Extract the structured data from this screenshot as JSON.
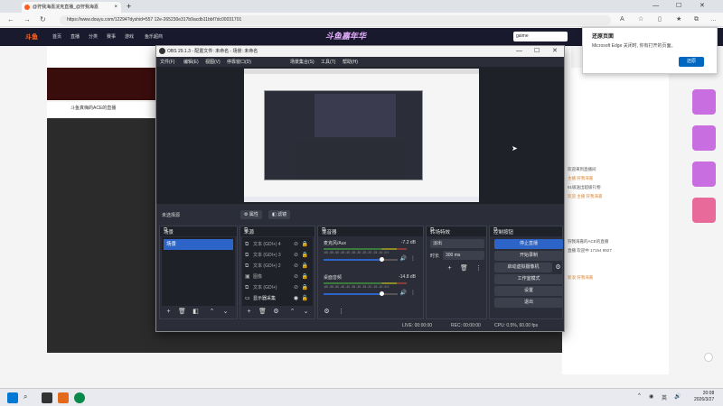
{
  "browser": {
    "tab_title": "@狩我海嘉浣克直播_@狩我海嘉",
    "url": "https://www.douyu.com/12294?dyshid=557 12e-265230e317b9acdb11bbf7dc00031701",
    "search_value": "gaime"
  },
  "douyu": {
    "nav": [
      "首页",
      "直播",
      "分类",
      "赛事",
      "游戏",
      "鱼乐超商"
    ],
    "banner_text": "斗鱼嘉年华",
    "stream_title": "斗鱼真嗨的ACE的直播",
    "notify_title": "还原页面",
    "notify_body": "Microsoft Edge 关闭时, 你有打开的页面。",
    "notify_button": "还原",
    "chat": [
      {
        "text": "欢迎来到直播间",
        "orange": false
      },
      {
        "text": "主播 狩我海嘉",
        "orange": true
      },
      {
        "text": "61级送出超级礼物",
        "orange": false
      },
      {
        "text": "欢迎 主播 狩我海嘉",
        "orange": true
      },
      {
        "text": "狩我海嘉的ACE的直播",
        "orange": false
      },
      {
        "text": "直播 欢迎中 17154 9927",
        "orange": false
      },
      {
        "text": "新浪 狩我海嘉",
        "orange": true
      }
    ]
  },
  "obs": {
    "title": "OBS 29.1.3 - 配置文件: 未命名 - 场景: 未命名",
    "menu": [
      "文件(F)",
      "编辑(E)",
      "视图(V)",
      "停靠窗口(D)",
      "场景集合(S)",
      "工具(T)",
      "帮助(H)"
    ],
    "scene_label": "未选择源",
    "props_button": "属性",
    "filters_button": "滤镜",
    "docks": {
      "scenes": {
        "title": "场景",
        "items": [
          "场景"
        ]
      },
      "sources": {
        "title": "来源",
        "items": [
          {
            "name": "文本 (GDI+) 4",
            "icon": "text-icon"
          },
          {
            "name": "文本 (GDI+) 3",
            "icon": "text-icon"
          },
          {
            "name": "文本 (GDI+) 2",
            "icon": "text-icon"
          },
          {
            "name": "图像",
            "icon": "image-icon"
          },
          {
            "name": "文本 (GDI+)",
            "icon": "text-icon"
          },
          {
            "name": "显示器采集",
            "icon": "monitor-icon"
          }
        ]
      },
      "mixer": {
        "title": "混音器",
        "ticks": "-60 -55 -50 -45 -40 -35 -30 -25 -20 -15 -10 -5 0",
        "channels": [
          {
            "name": "麦克风/Aux",
            "db": "-7.2 dB",
            "volume": 0.72
          },
          {
            "name": "桌面音频",
            "db": "-14.8 dB",
            "volume": 0.72
          }
        ]
      },
      "transitions": {
        "title": "转场特效",
        "type": "淡出",
        "duration_label": "时长",
        "duration": "300 ms"
      },
      "controls": {
        "title": "控制按钮",
        "buttons": [
          "停止直播",
          "开始录制",
          "启动虚拟摄像机",
          "工作室模式",
          "设置",
          "退出"
        ]
      }
    },
    "status": {
      "live": "LIVE: 00:00:00",
      "rec": "REC: 00:00:00",
      "cpu": "CPU: 0.5%, 60.00 fps"
    }
  },
  "taskbar": {
    "ime": "英",
    "time": "20:08",
    "date": "2026/3/27"
  }
}
